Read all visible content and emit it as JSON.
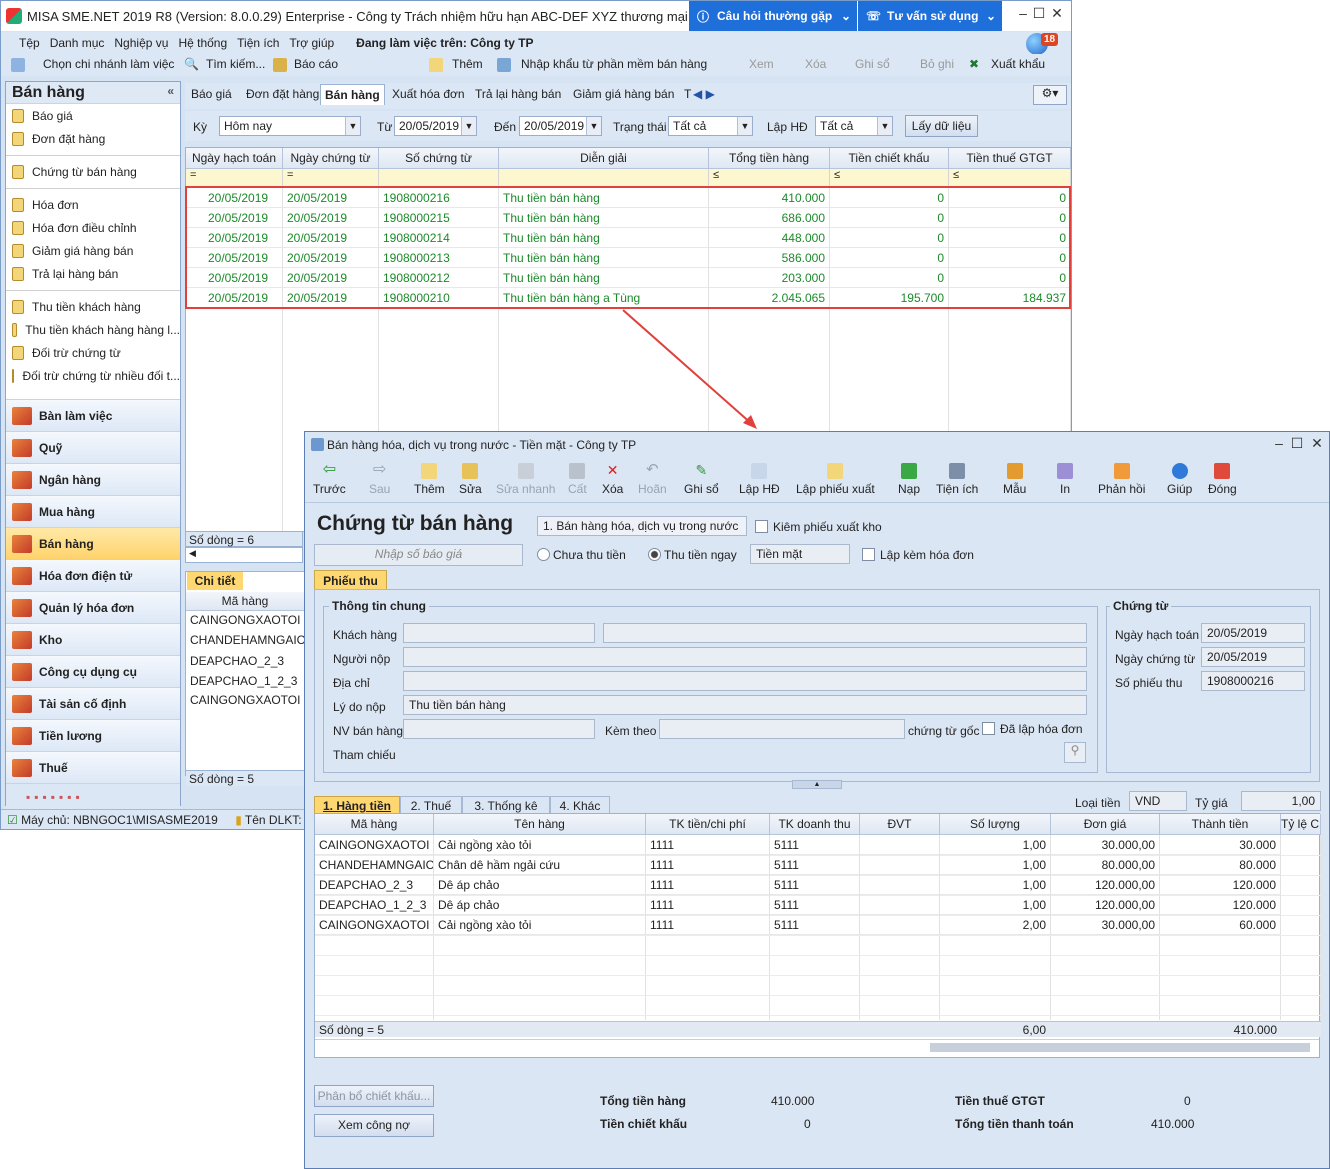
{
  "app": {
    "title": "MISA SME.NET 2019 R8 (Version: 8.0.0.29) Enterprise - Công ty Trách nhiệm hữu hạn ABC-DEF XYZ thương mại dịch vụ",
    "faq": "Câu hỏi thường gặp",
    "consult": "Tư vấn sử dụng",
    "notif_count": "18"
  },
  "menu": [
    "Tệp",
    "Danh mục",
    "Nghiệp vụ",
    "Hệ thống",
    "Tiện ích",
    "Trợ giúp"
  ],
  "menu_status": "Đang làm việc trên: Công ty TP",
  "toolbar": {
    "branch": "Chọn chi nhánh làm việc",
    "search": "Tìm kiếm...",
    "report": "Báo cáo",
    "add": "Thêm",
    "import": "Nhập khẩu từ phần mềm bán hàng",
    "view": "Xem",
    "delete": "Xóa",
    "post": "Ghi sổ",
    "unpost": "Bỏ ghi",
    "export": "Xuất khẩu"
  },
  "sidebar": {
    "title": "Bán hàng",
    "items": [
      "Báo giá",
      "Đơn đặt hàng",
      "Chứng từ bán hàng",
      "Hóa đơn",
      "Hóa đơn điều chỉnh",
      "Giảm giá hàng bán",
      "Trả lại hàng bán",
      "Thu tiền khách hàng",
      "Thu tiền khách hàng hàng l...",
      "Đối trừ chứng từ",
      "Đối trừ chứng từ nhiều đối t..."
    ],
    "modules": [
      "Bàn làm việc",
      "Quỹ",
      "Ngân hàng",
      "Mua hàng",
      "Bán hàng",
      "Hóa đơn điện tử",
      "Quản lý hóa đơn",
      "Kho",
      "Công cụ dụng cụ",
      "Tài sản cố định",
      "Tiền lương",
      "Thuế"
    ]
  },
  "tabs": [
    "Báo giá",
    "Đơn đặt hàng",
    "Bán hàng",
    "Xuất hóa đơn",
    "Trả lại hàng bán",
    "Giảm giá hàng bán",
    "T"
  ],
  "filter": {
    "period_label": "Kỳ",
    "period": "Hôm nay",
    "from_label": "Từ",
    "from": "20/05/2019",
    "to_label": "Đến",
    "to": "20/05/2019",
    "status_label": "Trạng thái",
    "status": "Tất cả",
    "invoice_label": "Lập HĐ",
    "invoice": "Tất cả",
    "get_button": "Lấy dữ liệu"
  },
  "grid1": {
    "headers": [
      "Ngày hạch toán",
      "Ngày chứng từ",
      "Số chứng từ",
      "Diễn giải",
      "Tổng tiền hàng",
      "Tiền chiết khấu",
      "Tiền thuế GTGT"
    ],
    "filter_ops": [
      "=",
      "=",
      "",
      "",
      "≤",
      "≤",
      "≤"
    ],
    "rows": [
      [
        "20/05/2019",
        "20/05/2019",
        "1908000216",
        "Thu tiền bán hàng",
        "410.000",
        "0",
        "0"
      ],
      [
        "20/05/2019",
        "20/05/2019",
        "1908000215",
        "Thu tiền bán hàng",
        "686.000",
        "0",
        "0"
      ],
      [
        "20/05/2019",
        "20/05/2019",
        "1908000214",
        "Thu tiền bán hàng",
        "448.000",
        "0",
        "0"
      ],
      [
        "20/05/2019",
        "20/05/2019",
        "1908000213",
        "Thu tiền bán hàng",
        "586.000",
        "0",
        "0"
      ],
      [
        "20/05/2019",
        "20/05/2019",
        "1908000212",
        "Thu tiền bán hàng",
        "203.000",
        "0",
        "0"
      ],
      [
        "20/05/2019",
        "20/05/2019",
        "1908000210",
        "Thu tiền bán hàng a Tùng",
        "2.045.065",
        "195.700",
        "184.937"
      ]
    ],
    "row_count": "Số dòng = 6"
  },
  "detail": {
    "tab": "Chi tiết",
    "header": "Mã hàng",
    "rows": [
      "CAINGONGXAOTOI",
      "CHANDEHAMNGAIC",
      "DEAPCHAO_2_3",
      "DEAPCHAO_1_2_3",
      "CAINGONGXAOTOI"
    ],
    "row_count": "Số dòng = 5"
  },
  "statusbar": {
    "server": "Máy chủ: NBNGOC1\\MISASME2019",
    "db": "Tên DLKT: CU"
  },
  "dialog": {
    "title": "Bán hàng hóa, dịch vụ trong nước - Tiền mặt - Công ty TP",
    "toolbar": [
      "Trước",
      "Sau",
      "Thêm",
      "Sửa",
      "Sửa nhanh",
      "Cất",
      "Xóa",
      "Hoãn",
      "Ghi sổ",
      "Lập HĐ",
      "Lập phiếu xuất",
      "Nạp",
      "Tiện ích",
      "Mẫu",
      "In",
      "Phản hồi",
      "Giúp",
      "Đóng"
    ],
    "heading": "Chứng từ bán hàng",
    "type": "1. Bán hàng hóa, dịch vụ trong nước",
    "check_stock": "Kiêm phiếu xuất kho",
    "quote_placeholder": "Nhập số báo giá",
    "unpaid": "Chưa thu tiền",
    "paid": "Thu tiền ngay",
    "method": "Tiền mặt",
    "with_invoice": "Lập kèm hóa đơn",
    "subtab": "Phiếu thu",
    "general_title": "Thông tin chung",
    "customer_label": "Khách hàng",
    "payer_label": "Người nộp",
    "address_label": "Địa chỉ",
    "reason_label": "Lý do nộp",
    "reason": "Thu tiền bán hàng",
    "seller_label": "NV bán hàng",
    "attach_label": "Kèm theo",
    "orig_label": "chứng từ gốc",
    "invoiced_label": "Đã lập hóa đơn",
    "ref_label": "Tham chiếu",
    "voucher_title": "Chứng từ",
    "post_date_label": "Ngày hạch toán",
    "post_date": "20/05/2019",
    "voucher_date_label": "Ngày chứng từ",
    "voucher_date": "20/05/2019",
    "receipt_no_label": "Số phiếu thu",
    "receipt_no": "1908000216",
    "detail_tabs": [
      "1. Hàng tiền",
      "2. Thuế",
      "3. Thống kê",
      "4. Khác"
    ],
    "currency_label": "Loại tiền",
    "currency": "VND",
    "rate_label": "Tỷ giá",
    "rate": "1,00",
    "grid_headers": [
      "Mã hàng",
      "Tên hàng",
      "TK tiền/chi phí",
      "TK doanh thu",
      "ĐVT",
      "Số lượng",
      "Đơn giá",
      "Thành tiền",
      "Tỷ lệ CK"
    ],
    "grid_rows": [
      [
        "CAINGONGXAOTOI",
        "Cải ngồng xào tỏi",
        "1111",
        "5111",
        "",
        "1,00",
        "30.000,00",
        "30.000"
      ],
      [
        "CHANDEHAMNGAIC",
        "Chân dê hầm ngải cứu",
        "1111",
        "5111",
        "",
        "1,00",
        "80.000,00",
        "80.000"
      ],
      [
        "DEAPCHAO_2_3",
        "Dê áp chảo",
        "1111",
        "5111",
        "",
        "1,00",
        "120.000,00",
        "120.000"
      ],
      [
        "DEAPCHAO_1_2_3",
        "Dê áp chảo",
        "1111",
        "5111",
        "",
        "1,00",
        "120.000,00",
        "120.000"
      ],
      [
        "CAINGONGXAOTOI",
        "Cải ngồng xào tỏi",
        "1111",
        "5111",
        "",
        "2,00",
        "30.000,00",
        "60.000"
      ]
    ],
    "row_count": "Số dòng = 5",
    "sum_qty": "6,00",
    "sum_amount": "410.000",
    "discount_btn": "Phân bổ chiết khấu...",
    "debt_btn": "Xem công nợ",
    "total_goods_label": "Tổng tiền hàng",
    "total_goods": "410.000",
    "discount_label": "Tiền chiết khấu",
    "discount": "0",
    "vat_label": "Tiền thuế GTGT",
    "vat": "0",
    "total_pay_label": "Tổng tiền thanh toán",
    "total_pay": "410.000"
  }
}
